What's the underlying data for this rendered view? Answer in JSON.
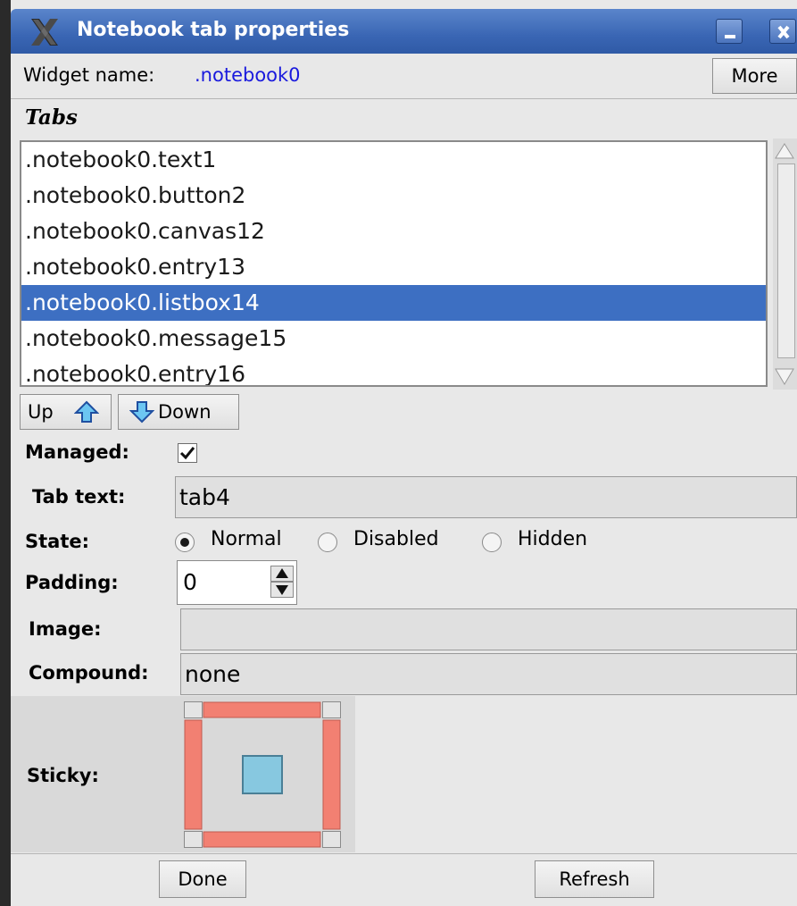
{
  "window": {
    "title": "Notebook tab properties",
    "title_icon": "x-window-icon",
    "controls": [
      "minimize-icon",
      "close-icon"
    ]
  },
  "header": {
    "widget_name_label": "Widget name:",
    "widget_name_value": ".notebook0",
    "more_label": "More"
  },
  "tabs": {
    "heading": "Tabs",
    "items": [
      ".notebook0.text1",
      ".notebook0.button2",
      ".notebook0.canvas12",
      ".notebook0.entry13",
      ".notebook0.listbox14",
      ".notebook0.message15",
      ".notebook0.entry16"
    ],
    "selected": ".notebook0.listbox14",
    "up_label": "Up",
    "down_label": "Down"
  },
  "form": {
    "managed_label": "Managed:",
    "managed_checked": true,
    "tab_text_label": "Tab text:",
    "tab_text_value": "tab4",
    "state_label": "State:",
    "state_options": [
      "Normal",
      "Disabled",
      "Hidden"
    ],
    "state_selected": "Normal",
    "padding_label": "Padding:",
    "padding_value": "0",
    "image_label": "Image:",
    "image_value": "",
    "compound_label": "Compound:",
    "compound_value": "none",
    "sticky_label": "Sticky:"
  },
  "footer": {
    "done_label": "Done",
    "refresh_label": "Refresh"
  },
  "colors": {
    "titlebar": "#3a66b4",
    "selection": "#3d6fc2",
    "link_blue": "#1a1add",
    "sticky_bar": "#f28072",
    "sticky_center": "#87c8e0"
  }
}
